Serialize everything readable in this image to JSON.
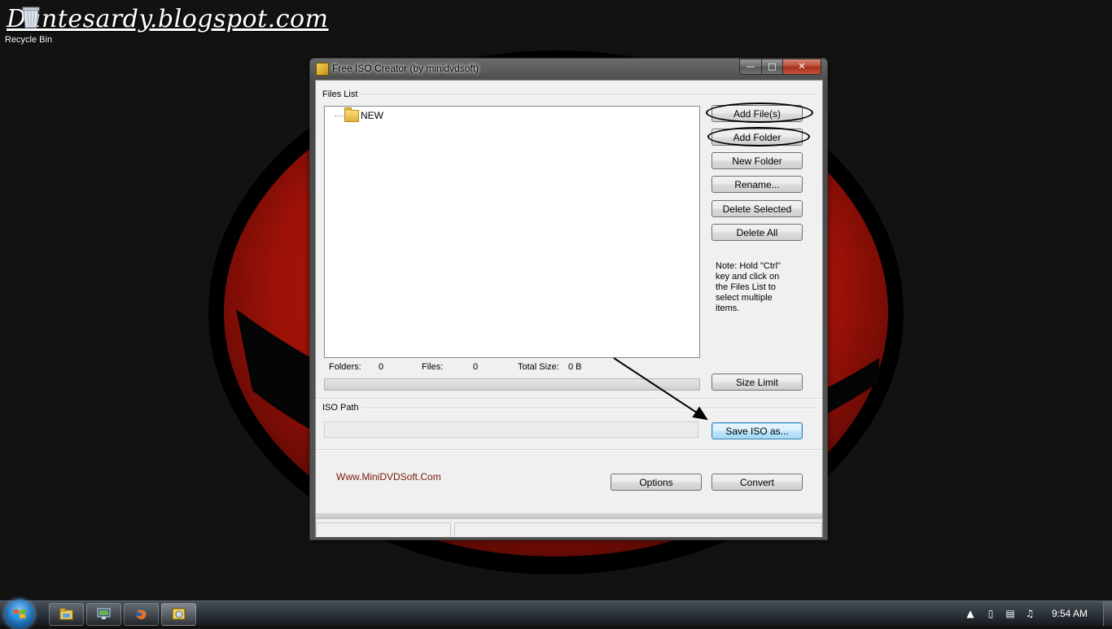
{
  "desktop": {
    "watermark": "Dantesardy.blogspot.com",
    "icons": [
      {
        "label": "Recycle Bin",
        "icon": "recycle-bin-icon"
      }
    ],
    "wallpaper_colors": {
      "background": "#121212",
      "ring": "#000000",
      "red": "#b5160c"
    }
  },
  "window": {
    "title": "Free ISO Creator (by minidvdsoft)",
    "files_list": {
      "label": "Files List",
      "tree_items": [
        {
          "label": "NEW",
          "icon": "folder-icon"
        }
      ]
    },
    "buttons": {
      "add_files": "Add File(s)",
      "add_folder": "Add Folder",
      "new_folder": "New Folder",
      "rename": "Rename...",
      "delete_selected": "Delete Selected",
      "delete_all": "Delete All",
      "size_limit": "Size Limit",
      "save_iso_as": "Save ISO as...",
      "options": "Options",
      "convert": "Convert"
    },
    "note": "Note: Hold \"Ctrl\" key and click on the Files List to select multiple items.",
    "stats": {
      "folders_label": "Folders:",
      "folders_value": "0",
      "files_label": "Files:",
      "files_value": "0",
      "total_size_label": "Total Size:",
      "total_size_value": "0 B"
    },
    "progress_fraction": 0,
    "iso_path": {
      "label": "ISO Path",
      "value": ""
    },
    "website": "Www.MiniDVDSoft.Com"
  },
  "taskbar": {
    "pinned": [
      "windows-explorer-icon",
      "remote-desktop-icon",
      "firefox-icon",
      "free-iso-creator-icon"
    ],
    "clock": "9:54 AM"
  },
  "colors": {
    "accent_link": "#7a1a0a",
    "focus_button": "#3c7fb1"
  }
}
